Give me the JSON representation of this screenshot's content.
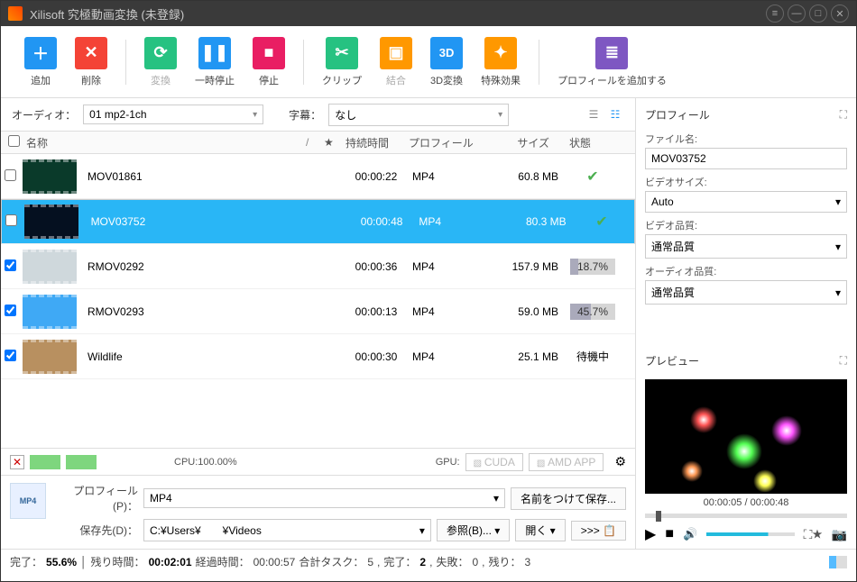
{
  "title": "Xilisoft 究極動画変換 (未登録)",
  "toolbar": {
    "add": "追加",
    "del": "削除",
    "conv": "変換",
    "pause": "一時停止",
    "stop": "停止",
    "clip": "クリップ",
    "merge": "結合",
    "3d": "3D変換",
    "fx": "特殊効果",
    "addprof": "プロフィールを追加する"
  },
  "filter": {
    "audio_lbl": "オーディオ：",
    "audio_val": "01 mp2-1ch",
    "sub_lbl": "字幕：",
    "sub_val": "なし"
  },
  "columns": {
    "name": "名称",
    "star": "★",
    "dur": "持続時間",
    "prof": "プロフィール",
    "size": "サイズ",
    "stat": "状態"
  },
  "rows": [
    {
      "chk": false,
      "name": "MOV01861",
      "dur": "00:00:22",
      "prof": "MP4",
      "size": "60.8 MB",
      "stat": "done",
      "thumb": "#0a3a2a"
    },
    {
      "chk": false,
      "name": "MOV03752",
      "dur": "00:00:48",
      "prof": "MP4",
      "size": "80.3 MB",
      "stat": "done",
      "thumb": "#051020",
      "selected": true
    },
    {
      "chk": true,
      "name": "RMOV0292",
      "dur": "00:00:36",
      "prof": "MP4",
      "size": "157.9 MB",
      "stat": "18.7%",
      "pct": 18.7,
      "thumb": "#cfd8dc"
    },
    {
      "chk": true,
      "name": "RMOV0293",
      "dur": "00:00:13",
      "prof": "MP4",
      "size": "59.0 MB",
      "stat": "45.7%",
      "pct": 45.7,
      "thumb": "#3fa9f5"
    },
    {
      "chk": true,
      "name": "Wildlife",
      "dur": "00:00:30",
      "prof": "MP4",
      "size": "25.1 MB",
      "stat": "待機中",
      "thumb": "#b89060"
    }
  ],
  "gpu": {
    "cpu": "CPU:100.00%",
    "gpu": "GPU:",
    "cuda": "CUDA",
    "amd": "AMD APP"
  },
  "profile_panel": {
    "prof_lbl": "プロフィール(P)：",
    "prof_val": "MP4",
    "saveas": "名前をつけて保存...",
    "dest_lbl": "保存先(D)：",
    "dest_val": "C:¥Users¥　　¥Videos",
    "browse": "参照(B)...",
    "open": "開く",
    "more": ">>>"
  },
  "status": {
    "done_lbl": "完了：",
    "done_val": "55.6%",
    "rem_lbl": "残り時間：",
    "rem_val": "00:02:01",
    "elapsed_lbl": "経過時間：",
    "elapsed_val": "00:00:57",
    "tasks_lbl": "合計タスク：",
    "tasks_val": "5",
    "comp_lbl": "完了：",
    "comp_val": "2",
    "fail_lbl": "失敗：",
    "fail_val": "0",
    "left_lbl": "残り：",
    "left_val": "3"
  },
  "side": {
    "profile_head": "プロフィール",
    "filename_lbl": "ファイル名:",
    "filename_val": "MOV03752",
    "vsize_lbl": "ビデオサイズ:",
    "vsize_val": "Auto",
    "vq_lbl": "ビデオ品質:",
    "vq_val": "通常品質",
    "aq_lbl": "オーディオ品質:",
    "aq_val": "通常品質",
    "preview_head": "プレビュー",
    "time": "00:00:05 / 00:00:48"
  }
}
